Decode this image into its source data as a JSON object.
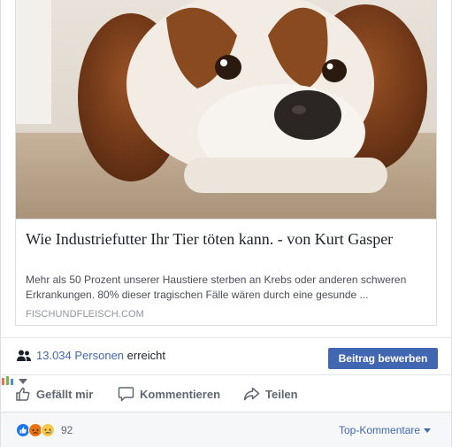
{
  "link_preview": {
    "title": "Wie Industriefutter Ihr Tier töten kann. - von Kurt Gasper",
    "description": "Mehr als 50 Prozent unserer Haustiere sterben an Krebs oder anderen schweren Erkrankungen. 80% dieser tragischen Fälle wären durch eine gesunde ...",
    "domain": "FISCHUNDFLEISCH.COM",
    "image_icon": "dog-photo"
  },
  "reach": {
    "icon": "people-icon",
    "count": "13.034",
    "persons_label": "Personen",
    "suffix": "erreicht",
    "promote_label": "Beitrag bewerben"
  },
  "actions": {
    "like_label": "Gefällt mir",
    "comment_label": "Kommentieren",
    "share_label": "Teilen"
  },
  "reactions": {
    "icons": [
      "like-reaction",
      "angry-reaction",
      "sad-reaction"
    ],
    "count": "92",
    "sort_label": "Top-Kommentare"
  },
  "colors": {
    "brand_blue": "#4267b2",
    "text_secondary": "#606770",
    "border": "#dddfe2"
  }
}
